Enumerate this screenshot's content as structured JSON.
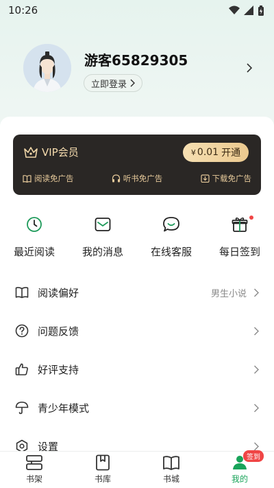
{
  "status": {
    "time": "10:26"
  },
  "profile": {
    "username": "游客65829305",
    "login_label": "立即登录"
  },
  "vip": {
    "title": "VIP会员",
    "price_symbol": "¥",
    "price": "0.01",
    "action": "开通",
    "perks": [
      "阅读免广告",
      "听书免广告",
      "下载免广告"
    ]
  },
  "quick_actions": [
    {
      "label": "最近阅读",
      "icon": "clock-icon"
    },
    {
      "label": "我的消息",
      "icon": "mail-icon"
    },
    {
      "label": "在线客服",
      "icon": "chat-icon"
    },
    {
      "label": "每日签到",
      "icon": "gift-icon"
    }
  ],
  "menu": [
    {
      "label": "阅读偏好",
      "value": "男生小说",
      "icon": "book-icon"
    },
    {
      "label": "问题反馈",
      "value": "",
      "icon": "question-icon"
    },
    {
      "label": "好评支持",
      "value": "",
      "icon": "thumbs-up-icon"
    },
    {
      "label": "青少年模式",
      "value": "",
      "icon": "umbrella-icon"
    },
    {
      "label": "设置",
      "value": "",
      "icon": "settings-icon"
    }
  ],
  "tabs": [
    {
      "label": "书架",
      "icon": "shelf-icon"
    },
    {
      "label": "书库",
      "icon": "library-icon"
    },
    {
      "label": "书城",
      "icon": "store-icon"
    },
    {
      "label": "我的",
      "icon": "profile-icon",
      "badge": "签到",
      "active": true
    }
  ],
  "colors": {
    "accent": "#19a45a",
    "vip_bg": "#2a2725",
    "vip_gold": "#f1d7a8",
    "badge": "#f04545"
  }
}
